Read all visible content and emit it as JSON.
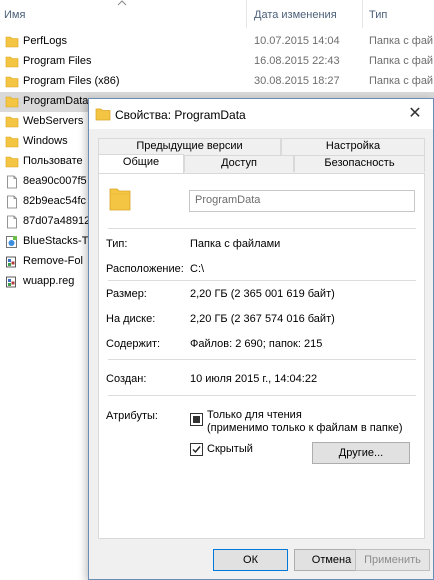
{
  "explorer": {
    "columns": {
      "name": "Имя",
      "date": "Дата изменения",
      "type": "Тип"
    },
    "rows": [
      {
        "name": "PerfLogs",
        "date": "10.07.2015 14:04",
        "type": "Папка с фай",
        "icon": "folder-icon"
      },
      {
        "name": "Program Files",
        "date": "16.08.2015 22:43",
        "type": "Папка с фай",
        "icon": "folder-icon"
      },
      {
        "name": "Program Files (x86)",
        "date": "30.08.2015 18:27",
        "type": "Папка с фай",
        "icon": "folder-icon"
      },
      {
        "name": "ProgramData",
        "date": "",
        "type": "",
        "icon": "folder-icon"
      },
      {
        "name": "WebServers",
        "date": "",
        "type": "",
        "icon": "folder-icon"
      },
      {
        "name": "Windows",
        "date": "",
        "type": "",
        "icon": "folder-icon"
      },
      {
        "name": "Пользовате",
        "date": "",
        "type": "",
        "icon": "folder-icon"
      },
      {
        "name": "8ea90c007f5",
        "date": "",
        "type": "",
        "icon": "file-icon"
      },
      {
        "name": "82b9eac54fc",
        "date": "",
        "type": "",
        "icon": "file-icon"
      },
      {
        "name": "87d07a48912",
        "date": "",
        "type": "",
        "icon": "file-icon"
      },
      {
        "name": "BlueStacks-T",
        "date": "",
        "type": "",
        "icon": "installer-icon"
      },
      {
        "name": "Remove-Fol",
        "date": "",
        "type": "",
        "icon": "reg-file-icon"
      },
      {
        "name": "wuapp.reg",
        "date": "",
        "type": "",
        "icon": "reg-file-icon"
      }
    ]
  },
  "dialog": {
    "title": "Свойства: ProgramData",
    "close_glyph": "✕",
    "tabs_top": [
      "Предыдущие версии",
      "Настройка"
    ],
    "tabs_bottom": [
      "Общие",
      "Доступ",
      "Безопасность"
    ],
    "active_tab": "Общие",
    "folder_name": "ProgramData",
    "fields": {
      "type_label": "Тип:",
      "type_value": "Папка с файлами",
      "location_label": "Расположение:",
      "location_value": "C:\\",
      "size_label": "Размер:",
      "size_value": "2,20 ГБ (2 365 001 619 байт)",
      "disk_label": "На диске:",
      "disk_value": "2,20 ГБ (2 367 574 016 байт)",
      "contains_label": "Содержит:",
      "contains_value": "Файлов: 2 690; папок: 215",
      "created_label": "Создан:",
      "created_value": "10 июля 2015 г., 14:04:22",
      "attributes_label": "Атрибуты:"
    },
    "attributes": {
      "readonly_label": "Только для чтения",
      "readonly_note": "(применимо только к файлам в папке)",
      "readonly_state": "indeterminate",
      "hidden_label": "Скрытый",
      "hidden_state": "checked",
      "other_button": "Другие..."
    },
    "buttons": {
      "ok": "ОК",
      "cancel": "Отмена",
      "apply": "Применить"
    }
  },
  "colors": {
    "folder": "#f4c542",
    "selection": "#d9d9d9",
    "dialog_border": "#6b8db6",
    "default_button_border": "#0078d7"
  }
}
